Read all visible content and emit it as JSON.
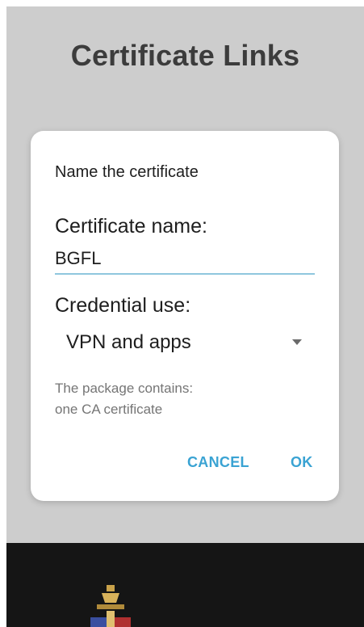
{
  "page": {
    "title": "Certificate Links"
  },
  "dialog": {
    "heading": "Name the certificate",
    "name_label": "Certificate name:",
    "name_value": "BGFL",
    "credential_label": "Credential use:",
    "credential_value": "VPN and apps",
    "info_line1": "The package contains:",
    "info_line2": "one CA certificate",
    "cancel_label": "CANCEL",
    "ok_label": "OK"
  },
  "footer": {
    "logo_icon": "crest-icon"
  },
  "colors": {
    "accent": "#3aa3d3",
    "underline": "#8fc7de",
    "background": "#cdcdcd",
    "footer_bg": "#151515"
  }
}
